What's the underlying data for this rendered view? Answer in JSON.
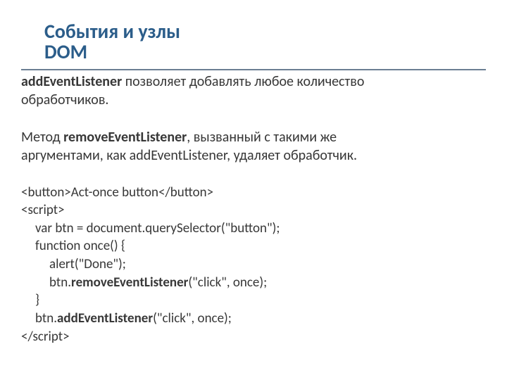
{
  "title_line1": "События и узлы",
  "title_line2": "DOM",
  "para1_strong": "addEventListener",
  "para1_rest1": " позволяет добавлять любое количество",
  "para1_rest2": "обработчиков.",
  "para2_pre": "Метод ",
  "para2_strong": "removeEventListener",
  "para2_mid": ", вызванный с такими же",
  "para2_line2_pre": "аргументами, как ",
  "para2_line2_code": "addEventListener,",
  "para2_line2_post": " удаляет обработчик.",
  "code": {
    "l1": "<button>Act-once button</button>",
    "l2": "<script>",
    "l3": "var btn = document.querySelector(\"button\");",
    "l4": "function once() {",
    "l5": "alert(\"Done\");",
    "l6_pre": "btn.",
    "l6_b": "removeEventListener",
    "l6_post": "(\"click\", once);",
    "l7": "}",
    "l8_pre": "btn.",
    "l8_b": "addEventListener",
    "l8_post": "(\"click\", once);",
    "l9": "</script>"
  }
}
